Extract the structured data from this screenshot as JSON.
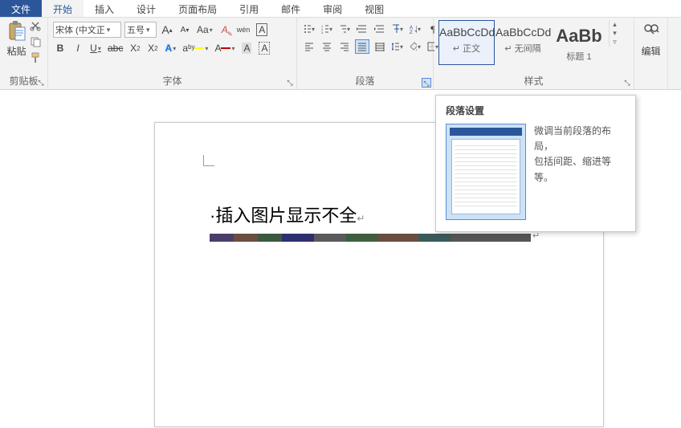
{
  "tabs": {
    "file": "文件",
    "home": "开始",
    "insert": "插入",
    "design": "设计",
    "layout": "页面布局",
    "references": "引用",
    "mailings": "邮件",
    "review": "审阅",
    "view": "视图"
  },
  "clipboard": {
    "paste_label": "粘贴",
    "group_label": "剪贴板"
  },
  "font": {
    "group_label": "字体",
    "name": "宋体 (中文正",
    "size": "五号",
    "grow": "A",
    "shrink": "A",
    "case": "Aa",
    "clear": "A",
    "phonetic": "wén",
    "charframe": "A",
    "bold": "B",
    "italic": "I",
    "underline": "U",
    "strike": "abc",
    "sub": "X",
    "sup": "X",
    "texteffect": "A",
    "highlight": "aᵇʸ",
    "fontcolor": "A",
    "charshade": "A",
    "charborder": "A"
  },
  "para": {
    "group_label": "段落"
  },
  "styles": {
    "group_label": "样式",
    "items": [
      {
        "preview": "AaBbCcDd",
        "name": "↵ 正文"
      },
      {
        "preview": "AaBbCcDd",
        "name": "↵ 无间隔"
      },
      {
        "preview": "AaBb",
        "name": "标题 1"
      }
    ]
  },
  "editing": {
    "label": "编辑"
  },
  "document": {
    "title_prefix": "·",
    "title": "插入图片显示不全",
    "title_return": "↵"
  },
  "tooltip": {
    "title": "段落设置",
    "line1": "微调当前段落的布局，",
    "line2": "包括间距、缩进等等。"
  }
}
